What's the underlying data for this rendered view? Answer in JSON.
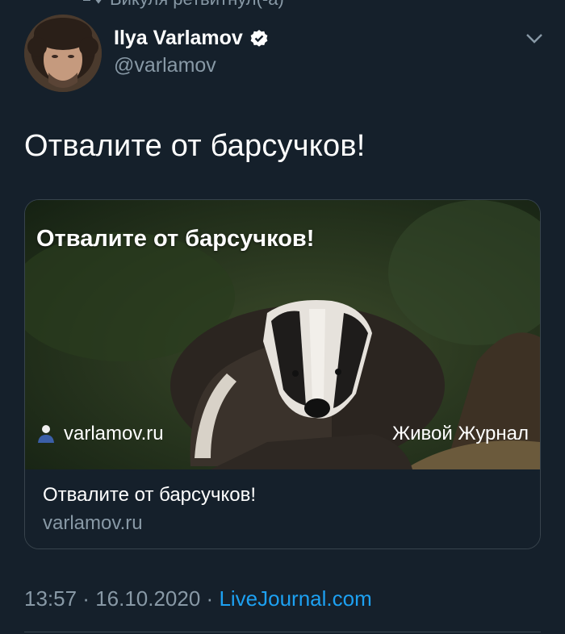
{
  "retweet": {
    "text": "Викуля ретвитнул(-а)"
  },
  "author": {
    "name": "Ilya Varlamov",
    "handle": "@varlamov",
    "verified": true
  },
  "tweet": {
    "text": "Отвалите от барсучков!"
  },
  "card": {
    "image_title": "Отвалите от барсучков!",
    "image_site": "varlamov.ru",
    "image_brand": "Живой Журнал",
    "title": "Отвалите от барсучков!",
    "domain": "varlamov.ru"
  },
  "footer": {
    "time": "13:57",
    "sep1": " · ",
    "date": "16.10.2020",
    "sep2": " · ",
    "source": "LiveJournal.com"
  },
  "colors": {
    "background": "#15202b",
    "muted": "#8899a6",
    "link": "#1da1f2",
    "border": "#38444d"
  }
}
